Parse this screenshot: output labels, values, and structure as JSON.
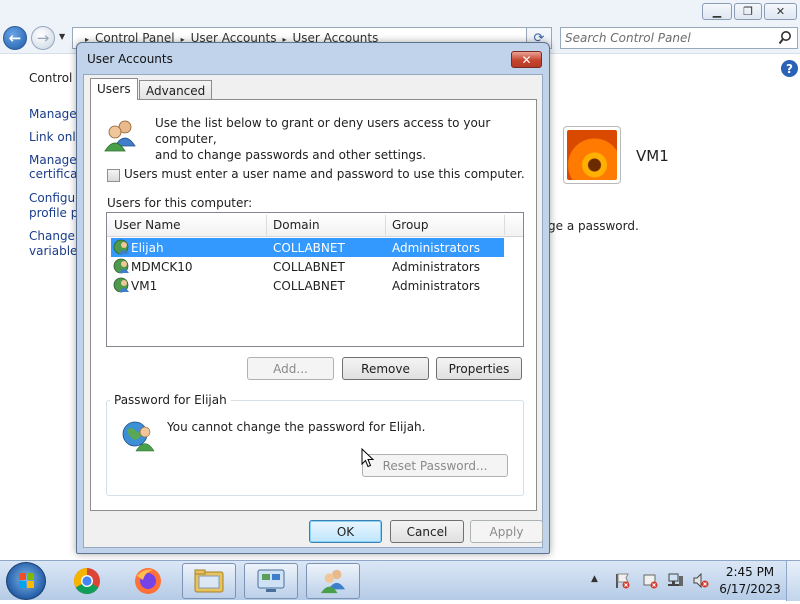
{
  "control_panel": {
    "breadcrumb": [
      "Control Panel",
      "User Accounts",
      "User Accounts"
    ],
    "search_placeholder": "Search Control Panel",
    "left_title": "Control P",
    "left_links": [
      "Manage",
      "Link onli",
      "Manage",
      "certificat",
      "Configur",
      "profile pr",
      "Change r",
      "variables"
    ],
    "right_text": "ge a password.",
    "account_name": "VM1"
  },
  "dialog": {
    "title": "User Accounts",
    "tabs": [
      "Users",
      "Advanced"
    ],
    "intro_line1": "Use the list below to grant or deny users access to your computer,",
    "intro_line2": "and to change passwords and other settings.",
    "require_login_label": "Users must enter a user name and password to use this computer.",
    "users_list_label": "Users for this computer:",
    "columns": [
      "User Name",
      "Domain",
      "Group"
    ],
    "users": [
      {
        "name": "Elijah",
        "domain": "COLLABNET",
        "group": "Administrators",
        "selected": true
      },
      {
        "name": "MDMCK10",
        "domain": "COLLABNET",
        "group": "Administrators",
        "selected": false
      },
      {
        "name": "VM1",
        "domain": "COLLABNET",
        "group": "Administrators",
        "selected": false
      }
    ],
    "buttons": {
      "add": "Add...",
      "remove": "Remove",
      "properties": "Properties"
    },
    "password_group_title": "Password for Elijah",
    "password_message": "You cannot change the password for Elijah.",
    "reset_password": "Reset Password...",
    "ok": "OK",
    "cancel": "Cancel",
    "apply": "Apply"
  },
  "taskbar": {
    "apps": [
      "start-orb",
      "chrome",
      "firefox",
      "windows-explorer",
      "control-panel",
      "user-accounts"
    ],
    "time": "2:45 PM",
    "date": "6/17/2023"
  },
  "colors": {
    "selection": "#3399ff",
    "dialog_frame": "#c1d3ea",
    "close_button": "#c6452f",
    "taskbar": "#b5cbe6"
  }
}
